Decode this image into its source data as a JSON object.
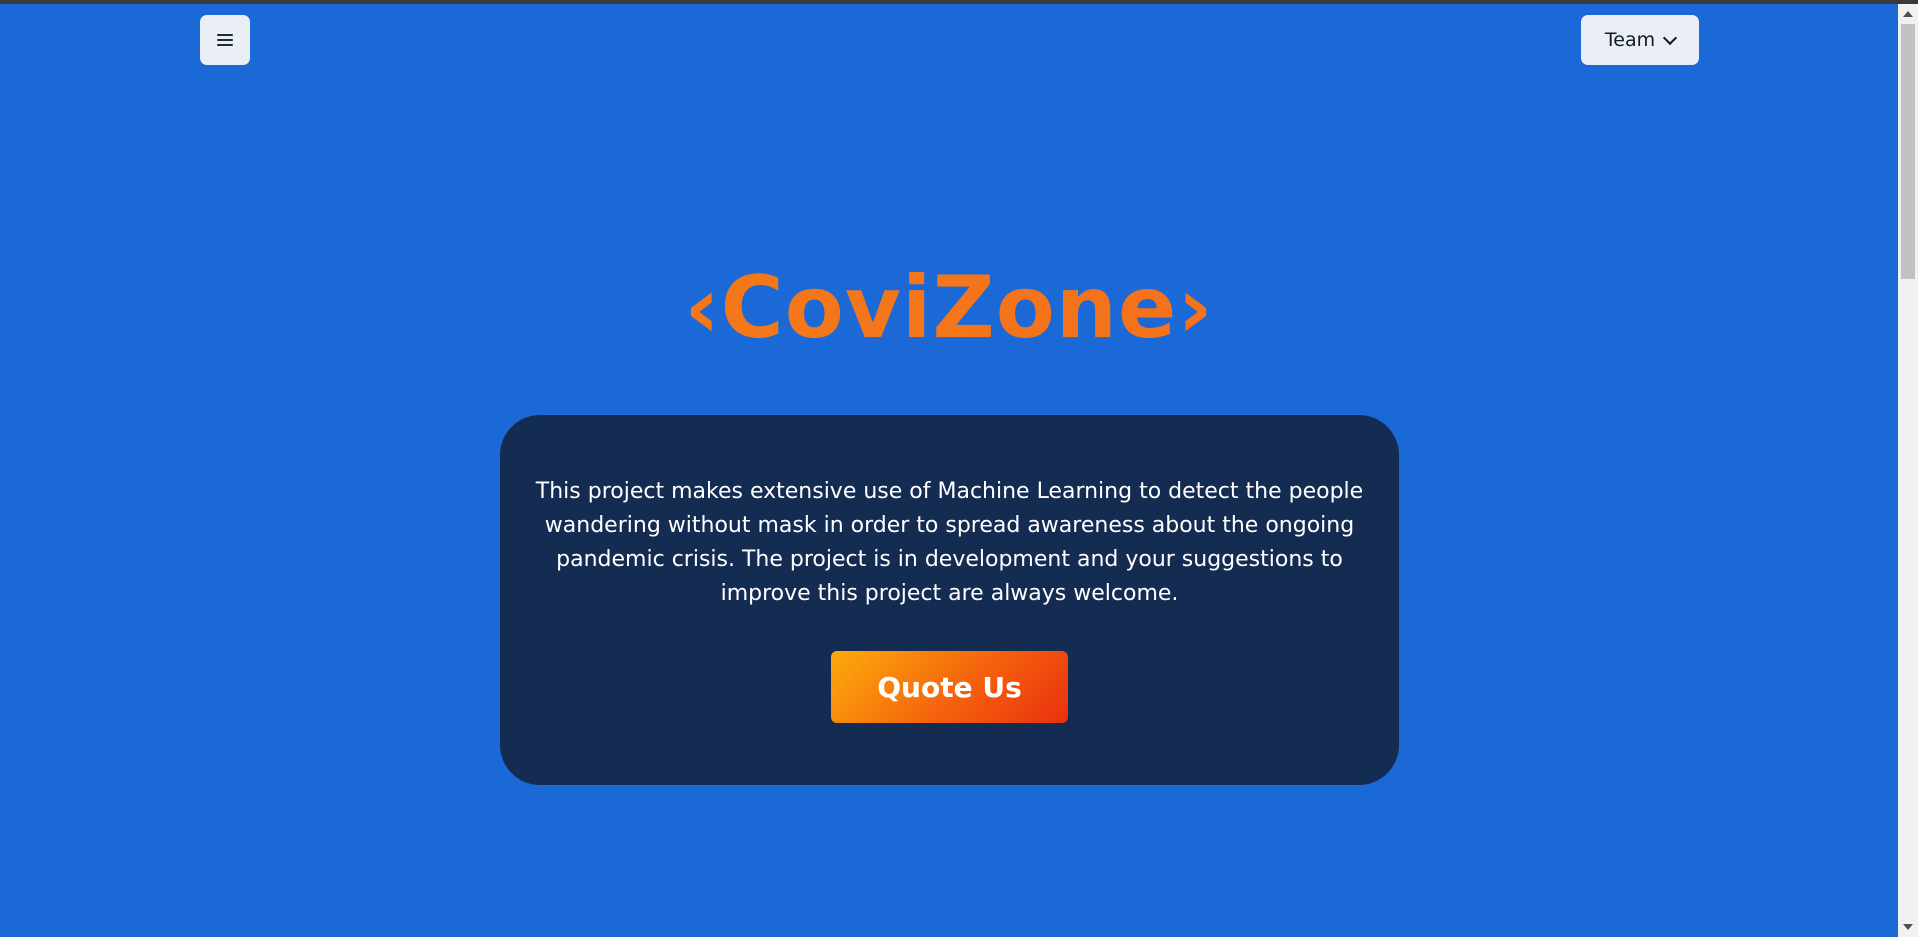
{
  "header": {
    "menu_icon": "hamburger-menu-icon",
    "team_dropdown": {
      "label": "Team",
      "icon": "chevron-down-icon"
    }
  },
  "hero": {
    "title": "‹CoviZone›",
    "description": "This project makes extensive use of Machine Learning to detect the people wandering without mask in order to spread awareness about the ongoing pandemic crisis. The project is in development and your suggestions to improve this project are always welcome.",
    "cta_label": "Quote Us"
  },
  "colors": {
    "background": "#1a69d6",
    "card": "#152c52",
    "brand_orange": "#f57a14",
    "button_gradient_start": "#fdab0a",
    "button_gradient_end": "#ea300e"
  }
}
